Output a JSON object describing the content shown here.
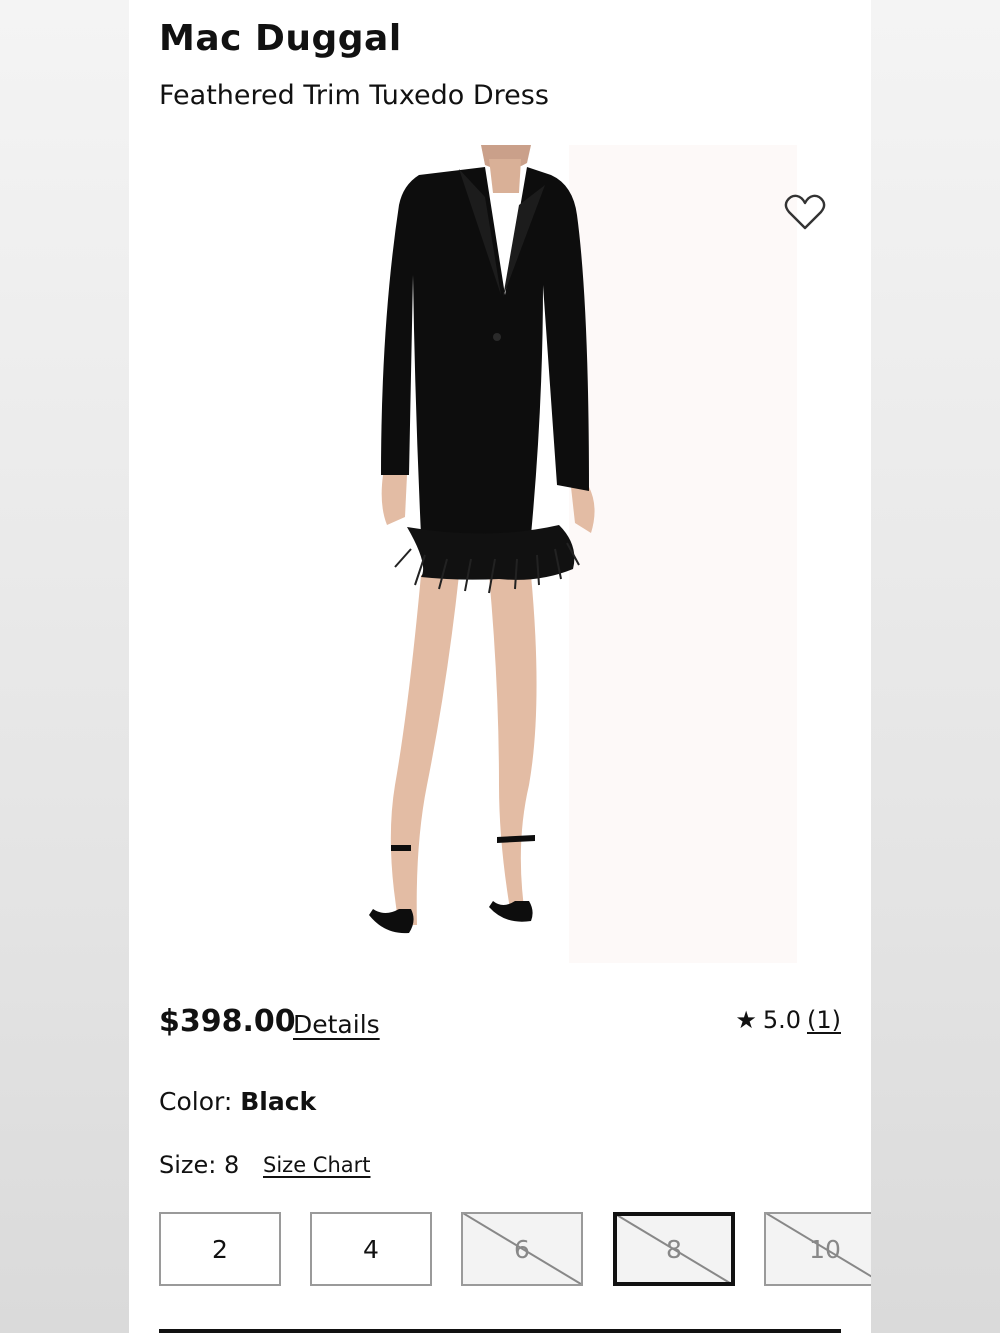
{
  "product": {
    "brand": "Mac Duggal",
    "name": "Feathered Trim Tuxedo Dress",
    "price": "$398.00",
    "details_label": "Details",
    "rating_value": "5.0",
    "rating_count": "(1)",
    "color_label": "Color: ",
    "color_value": "Black",
    "size_label": "Size: 8",
    "size_chart_label": "Size Chart"
  },
  "sizes": [
    {
      "label": "2",
      "available": true,
      "selected": false
    },
    {
      "label": "4",
      "available": true,
      "selected": false
    },
    {
      "label": "6",
      "available": false,
      "selected": false
    },
    {
      "label": "8",
      "available": false,
      "selected": true
    },
    {
      "label": "10",
      "available": false,
      "selected": false
    }
  ],
  "icons": {
    "favorite": "heart-outline-icon",
    "rating": "star-icon"
  },
  "colors": {
    "text": "#111111",
    "dress": "#0d0d0d",
    "border": "#9a9a9a",
    "selected_border": "#111111"
  }
}
